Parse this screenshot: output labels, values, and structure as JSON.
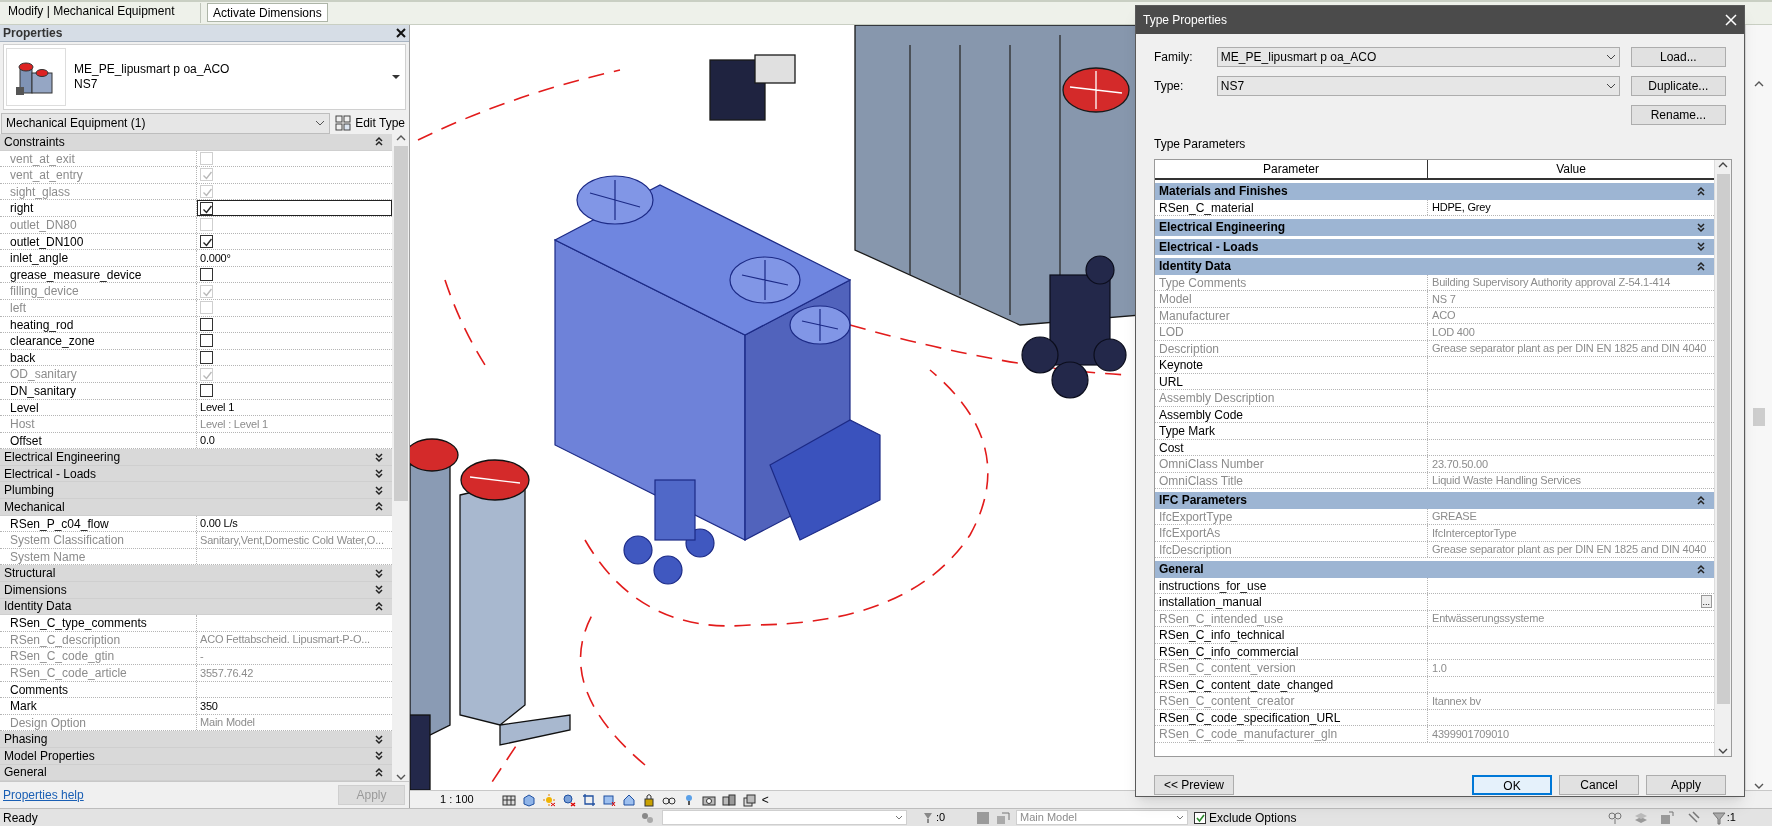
{
  "ribbon": {
    "context_label": "Modify | Mechanical Equipment",
    "button": "Activate Dimensions"
  },
  "properties": {
    "title": "Properties",
    "family": "ME_PE_lipusmart p oa_ACO",
    "type": "NS7",
    "selector": "Mechanical Equipment (1)",
    "edit_type": "Edit Type",
    "groups": [
      {
        "label": "Constraints",
        "expanded": true,
        "rows": [
          {
            "name": "vent_at_exit",
            "kind": "check",
            "checked": false,
            "disabled": true,
            "selected": false
          },
          {
            "name": "vent_at_entry",
            "kind": "check",
            "checked": true,
            "disabled": true,
            "selected": false
          },
          {
            "name": "sight_glass",
            "kind": "check",
            "checked": true,
            "disabled": true,
            "selected": false
          },
          {
            "name": "right",
            "kind": "check",
            "checked": true,
            "disabled": false,
            "selected": true
          },
          {
            "name": "outlet_DN80",
            "kind": "check",
            "checked": false,
            "disabled": true,
            "selected": false
          },
          {
            "name": "outlet_DN100",
            "kind": "check",
            "checked": true,
            "disabled": false,
            "selected": false
          },
          {
            "name": "inlet_angle",
            "kind": "text",
            "value": "0.000°",
            "disabled": false,
            "selected": false
          },
          {
            "name": "grease_measure_device",
            "kind": "check",
            "checked": false,
            "disabled": false,
            "selected": false
          },
          {
            "name": "filling_device",
            "kind": "check",
            "checked": true,
            "disabled": true,
            "selected": false
          },
          {
            "name": "left",
            "kind": "check",
            "checked": false,
            "disabled": true,
            "selected": false
          },
          {
            "name": "heating_rod",
            "kind": "check",
            "checked": false,
            "disabled": false,
            "selected": false
          },
          {
            "name": "clearance_zone",
            "kind": "check",
            "checked": false,
            "disabled": false,
            "selected": false
          },
          {
            "name": "back",
            "kind": "check",
            "checked": false,
            "disabled": false,
            "selected": false
          },
          {
            "name": "OD_sanitary",
            "kind": "check",
            "checked": true,
            "disabled": true,
            "selected": false
          },
          {
            "name": "DN_sanitary",
            "kind": "check",
            "checked": false,
            "disabled": false,
            "selected": false
          },
          {
            "name": "Level",
            "kind": "text",
            "value": "Level 1",
            "disabled": false,
            "selected": false
          },
          {
            "name": "Host",
            "kind": "text",
            "value": "Level : Level 1",
            "disabled": true,
            "selected": false
          },
          {
            "name": "Offset",
            "kind": "text",
            "value": "0.0",
            "disabled": false,
            "selected": false
          }
        ]
      },
      {
        "label": "Electrical Engineering",
        "expanded": false
      },
      {
        "label": "Electrical - Loads",
        "expanded": false
      },
      {
        "label": "Plumbing",
        "expanded": false
      },
      {
        "label": "Mechanical",
        "expanded": true,
        "rows": [
          {
            "name": "RSen_P_c04_flow",
            "kind": "text",
            "value": "0.00 L/s",
            "disabled": false,
            "selected": false
          },
          {
            "name": "System Classification",
            "kind": "text",
            "value": "Sanitary,Vent,Domestic Cold Water,O...",
            "disabled": true,
            "selected": false
          },
          {
            "name": "System Name",
            "kind": "text",
            "disabled": true,
            "selected": false
          }
        ]
      },
      {
        "label": "Structural",
        "expanded": false
      },
      {
        "label": "Dimensions",
        "expanded": false
      },
      {
        "label": "Identity Data",
        "expanded": true,
        "rows": [
          {
            "name": "RSen_C_type_comments",
            "kind": "text",
            "disabled": false,
            "selected": false
          },
          {
            "name": "RSen_C_description",
            "kind": "text",
            "value": "ACO Fettabscheid. Lipusmart-P-O...",
            "disabled": true,
            "selected": false
          },
          {
            "name": "RSen_C_code_gtin",
            "kind": "text",
            "value": "-",
            "disabled": true,
            "selected": false
          },
          {
            "name": "RSen_C_code_article",
            "kind": "text",
            "value": "3557.76.42",
            "disabled": true,
            "selected": false
          },
          {
            "name": "Comments",
            "kind": "text",
            "disabled": false,
            "selected": false
          },
          {
            "name": "Mark",
            "kind": "text",
            "value": "350",
            "disabled": false,
            "selected": false
          },
          {
            "name": "Design Option",
            "kind": "text",
            "value": "Main Model",
            "disabled": true,
            "selected": false
          }
        ]
      },
      {
        "label": "Phasing",
        "expanded": false
      },
      {
        "label": "Model Properties",
        "expanded": false
      },
      {
        "label": "General",
        "expanded": true
      }
    ],
    "help_link": "Properties help",
    "apply": {
      "label": "Apply",
      "disabled": true
    }
  },
  "view_bar": {
    "scale": "1 : 100",
    "collapse": "<"
  },
  "type_dialog": {
    "title": "Type Properties",
    "family_label": "Family:",
    "family": "ME_PE_lipusmart p oa_ACO",
    "type_label": "Type:",
    "type": "NS7",
    "buttons": [
      "Load...",
      "Duplicate...",
      "Rename..."
    ],
    "section_label": "Type Parameters",
    "columns": [
      "Parameter",
      "Value"
    ],
    "groups": [
      {
        "label": "Materials and Finishes",
        "expanded": true,
        "rows": [
          {
            "name": "RSen_C_material",
            "value": "HDPE, Grey",
            "disabled": false
          }
        ]
      },
      {
        "label": "Electrical Engineering",
        "expanded": false
      },
      {
        "label": "Electrical - Loads",
        "expanded": false
      },
      {
        "label": "Identity Data",
        "expanded": true,
        "rows": [
          {
            "name": "Type Comments",
            "value": "Building Supervisory Authority approval Z-54.1-414",
            "disabled": true
          },
          {
            "name": "Model",
            "value": "NS 7",
            "disabled": true
          },
          {
            "name": "Manufacturer",
            "value": "ACO",
            "disabled": true
          },
          {
            "name": "LOD",
            "value": "LOD 400",
            "disabled": true
          },
          {
            "name": "Description",
            "value": "Grease separator plant as per DIN EN 1825 and DIN 4040",
            "disabled": true
          },
          {
            "name": "Keynote",
            "disabled": false
          },
          {
            "name": "URL",
            "disabled": false
          },
          {
            "name": "Assembly Description",
            "disabled": true
          },
          {
            "name": "Assembly Code",
            "disabled": false
          },
          {
            "name": "Type Mark",
            "disabled": false
          },
          {
            "name": "Cost",
            "disabled": false
          },
          {
            "name": "OmniClass Number",
            "value": "23.70.50.00",
            "disabled": true
          },
          {
            "name": "OmniClass Title",
            "value": "Liquid Waste Handling Services",
            "disabled": true
          }
        ]
      },
      {
        "label": "IFC Parameters",
        "expanded": true,
        "rows": [
          {
            "name": "IfcExportType",
            "value": "GREASE",
            "disabled": true
          },
          {
            "name": "IfcExportAs",
            "value": "IfcInterceptorType",
            "disabled": true
          },
          {
            "name": "IfcDescription",
            "value": "Grease separator plant as per DIN EN 1825 and DIN 4040",
            "disabled": true
          }
        ]
      },
      {
        "label": "General",
        "expanded": true,
        "rows": [
          {
            "name": "instructions_for_use",
            "disabled": false
          },
          {
            "name": "installation_manual",
            "disabled": false,
            "browse_button": "..."
          },
          {
            "name": "RSen_C_intended_use",
            "value": "Entwässerungssysteme",
            "disabled": true
          },
          {
            "name": "RSen_C_info_technical",
            "disabled": false
          },
          {
            "name": "RSen_C_info_commercial",
            "disabled": false
          },
          {
            "name": "RSen_C_content_version",
            "value": "1.0",
            "disabled": true
          },
          {
            "name": "RSen_C_content_date_changed",
            "disabled": false
          },
          {
            "name": "RSen_C_content_creator",
            "value": "Itannex bv",
            "disabled": true
          },
          {
            "name": "RSen_C_code_specification_URL",
            "disabled": false
          },
          {
            "name": "RSen_C_code_manufacturer_gln",
            "value": "4399901709010",
            "disabled": true
          }
        ]
      }
    ],
    "preview_button": "<< Preview",
    "footer_buttons": [
      {
        "label": "OK",
        "default": true
      },
      {
        "label": "Cancel",
        "default": false
      },
      {
        "label": "Apply",
        "default": false
      }
    ]
  },
  "status_bar": {
    "text": "Ready",
    "count": ":0",
    "design_option": "Main Model",
    "exclude_options": {
      "label": "Exclude Options",
      "checked": true
    },
    "filter_count": ":1"
  }
}
